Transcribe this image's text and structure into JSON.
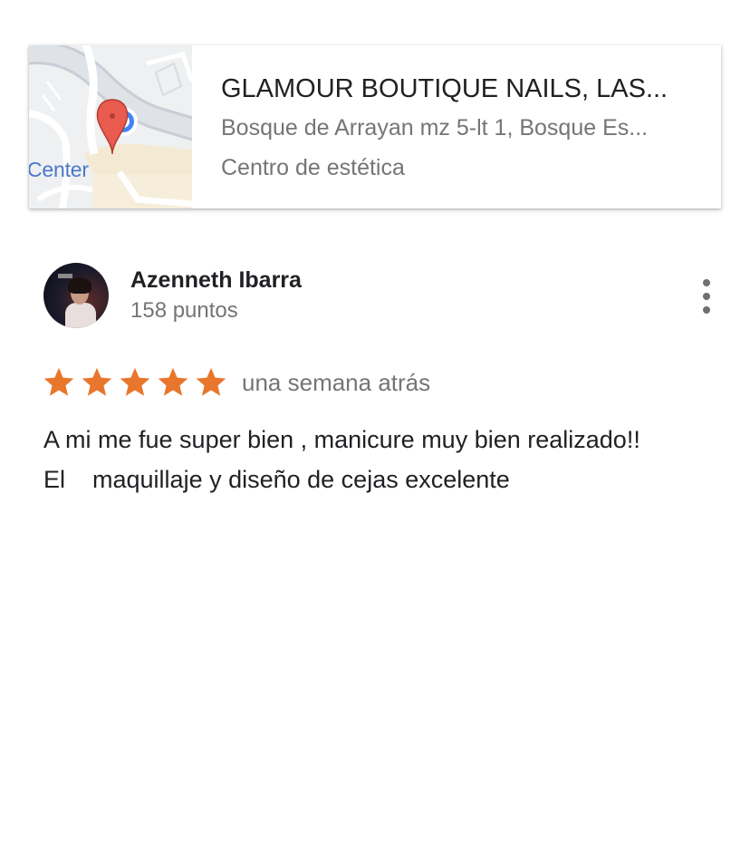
{
  "place": {
    "name": "GLAMOUR BOUTIQUE NAILS, LAS...",
    "address": "Bosque de Arrayan mz 5-lt 1, Bosque Es...",
    "category": "Centro de estética",
    "map_label": "Center"
  },
  "review": {
    "author": "Azenneth Ibarra",
    "points": "158 puntos",
    "rating": 5,
    "rating_max": 5,
    "time": "una semana atrás",
    "text": "A mi me fue super bien , manicure muy bien realizado!!\nEl    maquillaje y diseño de cejas excelente"
  },
  "icons": {
    "star": "star-icon",
    "more": "more-vert-icon",
    "pin": "map-pin-icon"
  },
  "colors": {
    "star": "#E8762C",
    "pin": "#EA5B4F",
    "text_secondary": "#757575"
  }
}
